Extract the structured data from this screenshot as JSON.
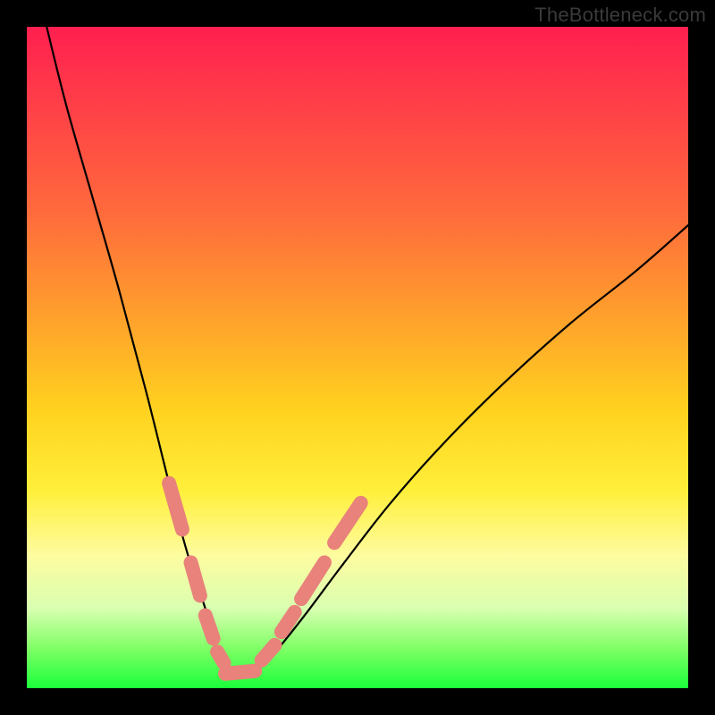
{
  "watermark": "TheBottleneck.com",
  "chart_data": {
    "type": "line",
    "title": "",
    "xlabel": "",
    "ylabel": "",
    "xlim": [
      0,
      100
    ],
    "ylim": [
      0,
      100
    ],
    "grid": false,
    "legend": false,
    "series": [
      {
        "name": "curve",
        "x": [
          3,
          6,
          10,
          14,
          18,
          21,
          23,
          25,
          27,
          28,
          29,
          30,
          31,
          33,
          35,
          38,
          42,
          48,
          55,
          63,
          72,
          82,
          92,
          100
        ],
        "values": [
          100,
          88,
          74,
          60,
          45,
          33,
          25,
          18,
          12,
          8,
          5,
          3,
          2,
          2,
          3,
          6,
          11,
          19,
          28,
          37,
          46,
          55,
          63,
          70
        ]
      }
    ],
    "overlay_segments": [
      {
        "name": "left-upper",
        "x": [
          21.5,
          23.5
        ],
        "values": [
          31,
          24
        ]
      },
      {
        "name": "left-mid",
        "x": [
          24.8,
          26.2
        ],
        "values": [
          19,
          14
        ]
      },
      {
        "name": "left-low1",
        "x": [
          27.0,
          28.2
        ],
        "values": [
          11,
          7.5
        ]
      },
      {
        "name": "left-low2",
        "x": [
          28.8,
          29.8
        ],
        "values": [
          5.5,
          3.8
        ]
      },
      {
        "name": "bottom",
        "x": [
          30.0,
          34.5
        ],
        "values": [
          2.2,
          2.6
        ]
      },
      {
        "name": "right-low1",
        "x": [
          35.5,
          37.5
        ],
        "values": [
          4.2,
          6.5
        ]
      },
      {
        "name": "right-low2",
        "x": [
          38.5,
          40.5
        ],
        "values": [
          8.5,
          11.5
        ]
      },
      {
        "name": "right-mid",
        "x": [
          41.5,
          45.0
        ],
        "values": [
          13.5,
          19
        ]
      },
      {
        "name": "right-upper",
        "x": [
          46.5,
          50.5
        ],
        "values": [
          22,
          28
        ]
      }
    ]
  }
}
